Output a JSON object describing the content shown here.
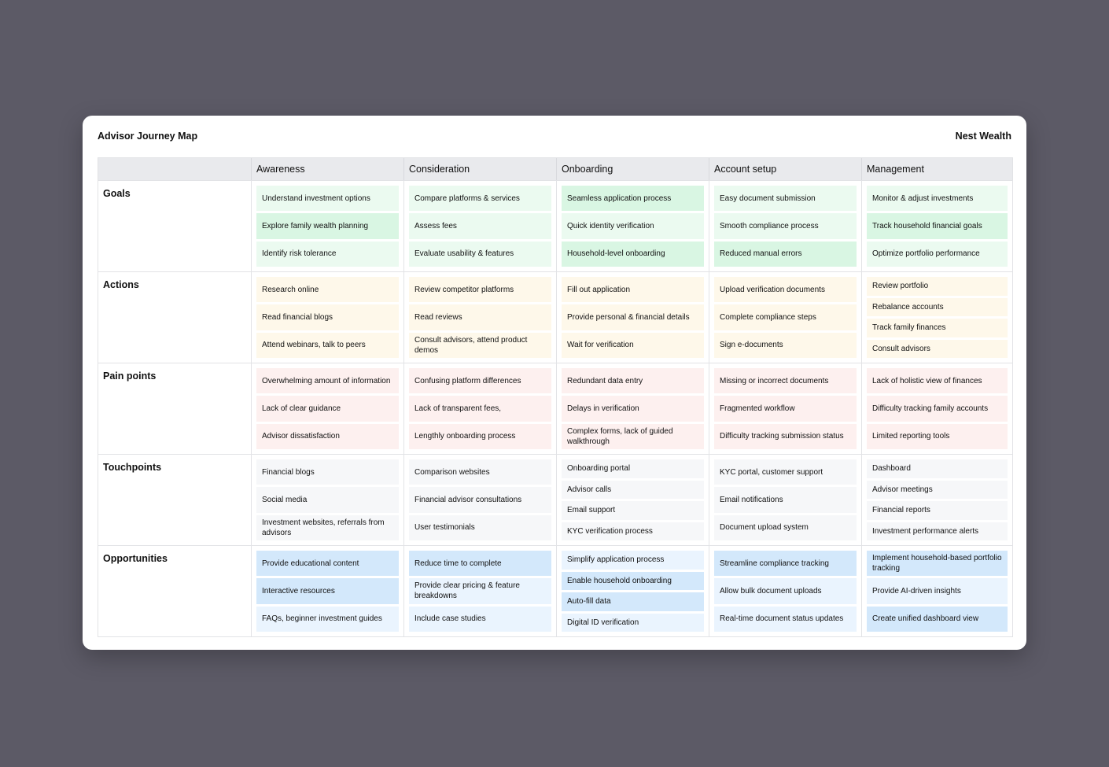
{
  "title": "Advisor Journey Map",
  "brand": "Nest Wealth",
  "stages": [
    "Awareness",
    "Consideration",
    "Onboarding",
    "Account setup",
    "Management"
  ],
  "colors": {
    "goals": {
      "light": "#ebfaf0",
      "strong": "#d9f6e3"
    },
    "actions": {
      "light": "#fef8ea",
      "strong": "#fdf1d8"
    },
    "pain_points": {
      "light": "#fdf0ef",
      "strong": "#fce5e3"
    },
    "touchpoints": {
      "light": "#f6f7f9",
      "strong": "#eceef1"
    },
    "opportunities": {
      "light": "#eaf4fe",
      "strong": "#d3e8fb"
    }
  },
  "rows": [
    {
      "label": "Goals",
      "key": "goals",
      "cells": [
        {
          "items": [
            {
              "text": "Understand investment options",
              "hl": false
            },
            {
              "text": "Explore family wealth planning",
              "hl": true
            },
            {
              "text": "Identify risk tolerance",
              "hl": false
            }
          ]
        },
        {
          "items": [
            {
              "text": "Compare platforms & services",
              "hl": false
            },
            {
              "text": "Assess fees",
              "hl": false
            },
            {
              "text": "Evaluate usability & features",
              "hl": false
            }
          ]
        },
        {
          "items": [
            {
              "text": "Seamless application process",
              "hl": true
            },
            {
              "text": "Quick identity verification",
              "hl": false
            },
            {
              "text": "Household-level onboarding",
              "hl": true
            }
          ]
        },
        {
          "items": [
            {
              "text": "Easy document submission",
              "hl": false
            },
            {
              "text": "Smooth compliance process",
              "hl": false
            },
            {
              "text": "Reduced manual errors",
              "hl": true
            }
          ]
        },
        {
          "items": [
            {
              "text": "Monitor & adjust investments",
              "hl": false
            },
            {
              "text": "Track household financial goals",
              "hl": true
            },
            {
              "text": "Optimize portfolio performance",
              "hl": false
            }
          ]
        }
      ]
    },
    {
      "label": "Actions",
      "key": "actions",
      "cells": [
        {
          "items": [
            {
              "text": "Research online",
              "hl": false
            },
            {
              "text": "Read financial blogs",
              "hl": false
            },
            {
              "text": "Attend webinars, talk to peers",
              "hl": false
            }
          ]
        },
        {
          "items": [
            {
              "text": "Review competitor platforms",
              "hl": false
            },
            {
              "text": "Read reviews",
              "hl": false
            },
            {
              "text": "Consult advisors, attend product demos",
              "hl": false
            }
          ]
        },
        {
          "items": [
            {
              "text": "Fill out application",
              "hl": false
            },
            {
              "text": "Provide personal & financial details",
              "hl": false
            },
            {
              "text": "Wait for verification",
              "hl": false
            }
          ]
        },
        {
          "items": [
            {
              "text": "Upload verification documents",
              "hl": false
            },
            {
              "text": "Complete compliance steps",
              "hl": false
            },
            {
              "text": "Sign e-documents",
              "hl": false
            }
          ]
        },
        {
          "items": [
            {
              "text": "Review portfolio",
              "hl": false
            },
            {
              "text": "Rebalance accounts",
              "hl": false
            },
            {
              "text": "Track family finances",
              "hl": false
            },
            {
              "text": "Consult advisors",
              "hl": false
            }
          ]
        }
      ]
    },
    {
      "label": "Pain points",
      "key": "pain_points",
      "cells": [
        {
          "items": [
            {
              "text": "Overwhelming amount of information",
              "hl": false
            },
            {
              "text": "Lack of clear guidance",
              "hl": false
            },
            {
              "text": "Advisor dissatisfaction",
              "hl": false
            }
          ]
        },
        {
          "items": [
            {
              "text": "Confusing platform differences",
              "hl": false
            },
            {
              "text": "Lack of transparent fees,",
              "hl": false
            },
            {
              "text": "Lengthly onboarding process",
              "hl": false
            }
          ]
        },
        {
          "items": [
            {
              "text": "Redundant data entry",
              "hl": false
            },
            {
              "text": "Delays in verification",
              "hl": false
            },
            {
              "text": "Complex forms, lack of guided walkthrough",
              "hl": false
            }
          ]
        },
        {
          "items": [
            {
              "text": "Missing or incorrect documents",
              "hl": false
            },
            {
              "text": "Fragmented workflow",
              "hl": false
            },
            {
              "text": "Difficulty tracking submission status",
              "hl": false
            }
          ]
        },
        {
          "items": [
            {
              "text": "Lack of holistic view of finances",
              "hl": false
            },
            {
              "text": "Difficulty tracking family accounts",
              "hl": false
            },
            {
              "text": "Limited reporting tools",
              "hl": false
            }
          ]
        }
      ]
    },
    {
      "label": "Touchpoints",
      "key": "touchpoints",
      "cells": [
        {
          "items": [
            {
              "text": "Financial blogs",
              "hl": false
            },
            {
              "text": "Social media",
              "hl": false
            },
            {
              "text": "Investment websites, referrals from advisors",
              "hl": false
            }
          ]
        },
        {
          "items": [
            {
              "text": "Comparison websites",
              "hl": false
            },
            {
              "text": "Financial advisor consultations",
              "hl": false
            },
            {
              "text": "User testimonials",
              "hl": false
            }
          ]
        },
        {
          "items": [
            {
              "text": "Onboarding portal",
              "hl": false
            },
            {
              "text": "Advisor calls",
              "hl": false
            },
            {
              "text": "Email support",
              "hl": false
            },
            {
              "text": "KYC verification process",
              "hl": false
            }
          ]
        },
        {
          "items": [
            {
              "text": "KYC portal, customer support",
              "hl": false
            },
            {
              "text": "Email notifications",
              "hl": false
            },
            {
              "text": "Document upload system",
              "hl": false
            }
          ]
        },
        {
          "items": [
            {
              "text": "Dashboard",
              "hl": false
            },
            {
              "text": "Advisor meetings",
              "hl": false
            },
            {
              "text": "Financial reports",
              "hl": false
            },
            {
              "text": "Investment performance alerts",
              "hl": false
            }
          ]
        }
      ]
    },
    {
      "label": "Opportunities",
      "key": "opportunities",
      "cells": [
        {
          "items": [
            {
              "text": "Provide educational content",
              "hl": true
            },
            {
              "text": "Interactive resources",
              "hl": true
            },
            {
              "text": "FAQs, beginner investment guides",
              "hl": false
            }
          ]
        },
        {
          "items": [
            {
              "text": "Reduce time to complete",
              "hl": true
            },
            {
              "text": "Provide clear pricing & feature breakdowns",
              "hl": false
            },
            {
              "text": "Include case studies",
              "hl": false
            }
          ]
        },
        {
          "items": [
            {
              "text": "Simplify application process",
              "hl": false
            },
            {
              "text": "Enable household onboarding",
              "hl": true
            },
            {
              "text": "Auto-fill data",
              "hl": true
            },
            {
              "text": "Digital ID verification",
              "hl": false
            }
          ]
        },
        {
          "items": [
            {
              "text": "Streamline compliance tracking",
              "hl": true
            },
            {
              "text": "Allow bulk document uploads",
              "hl": false
            },
            {
              "text": "Real-time document status updates",
              "hl": false
            }
          ]
        },
        {
          "items": [
            {
              "text": "Implement household-based portfolio tracking",
              "hl": true
            },
            {
              "text": "Provide AI-driven insights",
              "hl": false
            },
            {
              "text": "Create unified dashboard view",
              "hl": true
            }
          ]
        }
      ]
    }
  ]
}
